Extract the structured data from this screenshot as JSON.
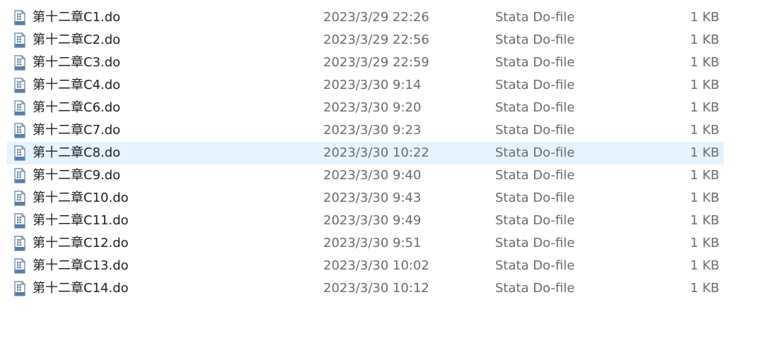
{
  "colors": {
    "icon": "#5a7ea3",
    "selection": "#e5f3ff",
    "name_text": "#1f1f1f",
    "detail_text": "#6b6b6b"
  },
  "files": [
    {
      "name": "第十二章C1.do",
      "modified": "2023/3/29 22:26",
      "type": "Stata Do-file",
      "size": "1 KB",
      "icon": "stata-do-file-icon",
      "selected": false
    },
    {
      "name": "第十二章C2.do",
      "modified": "2023/3/29 22:56",
      "type": "Stata Do-file",
      "size": "1 KB",
      "icon": "stata-do-file-icon",
      "selected": false
    },
    {
      "name": "第十二章C3.do",
      "modified": "2023/3/29 22:59",
      "type": "Stata Do-file",
      "size": "1 KB",
      "icon": "stata-do-file-icon",
      "selected": false
    },
    {
      "name": "第十二章C4.do",
      "modified": "2023/3/30 9:14",
      "type": "Stata Do-file",
      "size": "1 KB",
      "icon": "stata-do-file-icon",
      "selected": false
    },
    {
      "name": "第十二章C6.do",
      "modified": "2023/3/30 9:20",
      "type": "Stata Do-file",
      "size": "1 KB",
      "icon": "stata-do-file-icon",
      "selected": false
    },
    {
      "name": "第十二章C7.do",
      "modified": "2023/3/30 9:23",
      "type": "Stata Do-file",
      "size": "1 KB",
      "icon": "stata-do-file-icon",
      "selected": false
    },
    {
      "name": "第十二章C8.do",
      "modified": "2023/3/30 10:22",
      "type": "Stata Do-file",
      "size": "1 KB",
      "icon": "stata-do-file-icon",
      "selected": true
    },
    {
      "name": "第十二章C9.do",
      "modified": "2023/3/30 9:40",
      "type": "Stata Do-file",
      "size": "1 KB",
      "icon": "stata-do-file-icon",
      "selected": false
    },
    {
      "name": "第十二章C10.do",
      "modified": "2023/3/30 9:43",
      "type": "Stata Do-file",
      "size": "1 KB",
      "icon": "stata-do-file-icon",
      "selected": false
    },
    {
      "name": "第十二章C11.do",
      "modified": "2023/3/30 9:49",
      "type": "Stata Do-file",
      "size": "1 KB",
      "icon": "stata-do-file-icon",
      "selected": false
    },
    {
      "name": "第十二章C12.do",
      "modified": "2023/3/30 9:51",
      "type": "Stata Do-file",
      "size": "1 KB",
      "icon": "stata-do-file-icon",
      "selected": false
    },
    {
      "name": "第十二章C13.do",
      "modified": "2023/3/30 10:02",
      "type": "Stata Do-file",
      "size": "1 KB",
      "icon": "stata-do-file-icon",
      "selected": false
    },
    {
      "name": "第十二章C14.do",
      "modified": "2023/3/30 10:12",
      "type": "Stata Do-file",
      "size": "1 KB",
      "icon": "stata-do-file-icon",
      "selected": false
    }
  ]
}
